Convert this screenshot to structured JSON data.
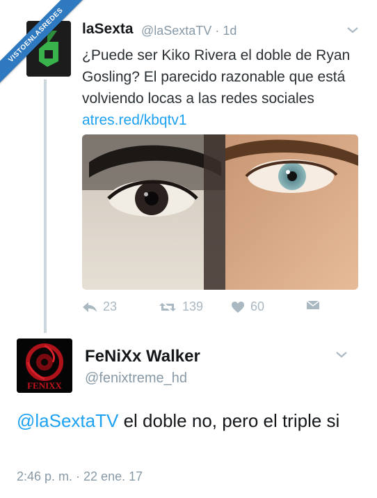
{
  "watermark": {
    "text": "VISTOENLASREDES"
  },
  "tweet1": {
    "name": "laSexta",
    "handle": "@laSextaTV",
    "separator": "·",
    "age": "1d",
    "text": "¿Puede ser Kiko Rivera el doble de Ryan Gosling? El parecido razonable que está volviendo locas a las redes sociales",
    "link": "atres.red/kbqtv1",
    "actions": {
      "reply_count": "23",
      "retweet_count": "139",
      "like_count": "60"
    }
  },
  "tweet2": {
    "name": "FeNiXx Walker",
    "handle": "@fenixtreme_hd",
    "avatar_text": "FENIXX",
    "mention": "@laSextaTV",
    "text": " el doble no, pero el triple si",
    "timestamp": "2:46 p. m. · 22 ene. 17"
  },
  "colors": {
    "link": "#1da1f2",
    "muted": "#8899a6",
    "icon": "#aab8c2",
    "brand_green": "#38b24a"
  }
}
